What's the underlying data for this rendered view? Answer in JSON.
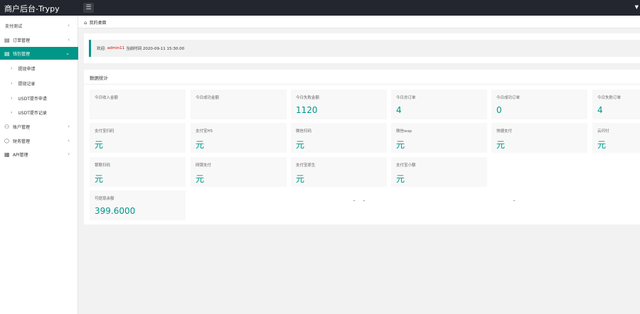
{
  "header": {
    "brand": "商户后台-Trypy",
    "menu_icon": "menu-icon"
  },
  "sidebar": {
    "items": [
      {
        "label": "支付测试"
      },
      {
        "label": "订单管理"
      },
      {
        "label": "钱包管理"
      },
      {
        "label": "提现申请"
      },
      {
        "label": "提现记录"
      },
      {
        "label": "USDT提币申请"
      },
      {
        "label": "USDT提币记录"
      },
      {
        "label": "账户管理"
      },
      {
        "label": "财务管理"
      },
      {
        "label": "API管理"
      }
    ]
  },
  "tabs": {
    "home": "我的桌面"
  },
  "welcome": {
    "prefix": "欢迎:",
    "user": "admin11",
    "time_label": "当前时间 2020-09-11 15:30:00"
  },
  "stats": {
    "title": "数据统计",
    "cards": [
      {
        "label": "今日收入金额",
        "value": ""
      },
      {
        "label": "今日成功金额",
        "value": ""
      },
      {
        "label": "今日失败金额",
        "value": "1120"
      },
      {
        "label": "今日总订单",
        "value": "4"
      },
      {
        "label": "今日成功订单",
        "value": "0"
      },
      {
        "label": "今日失败订单",
        "value": "4"
      },
      {
        "label": "支付宝扫码",
        "value": "元"
      },
      {
        "label": "支付宝H5",
        "value": "元"
      },
      {
        "label": "微信扫码",
        "value": "元"
      },
      {
        "label": "微信wap",
        "value": "元"
      },
      {
        "label": "快捷支付",
        "value": "元"
      },
      {
        "label": "云闪付",
        "value": "元"
      },
      {
        "label": "银联扫码",
        "value": "元"
      },
      {
        "label": "网银支付",
        "value": "元"
      },
      {
        "label": "支付宝原生",
        "value": "元"
      },
      {
        "label": "支付宝小额",
        "value": "元"
      },
      {
        "label": "可提现余额",
        "value": "399.6000"
      }
    ]
  }
}
